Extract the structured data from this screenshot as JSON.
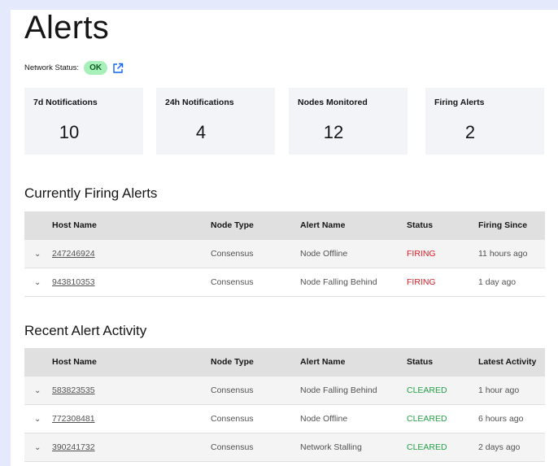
{
  "page": {
    "title": "Alerts"
  },
  "network": {
    "label": "Network Status:",
    "status": "OK",
    "icon": "external-link-icon"
  },
  "cards": [
    {
      "label": "7d Notifications",
      "value": "10"
    },
    {
      "label": "24h Notifications",
      "value": "4"
    },
    {
      "label": "Nodes Monitored",
      "value": "12"
    },
    {
      "label": "Firing Alerts",
      "value": "2"
    }
  ],
  "firing": {
    "title": "Currently Firing Alerts",
    "columns": [
      "Host Name",
      "Node Type",
      "Alert Name",
      "Status",
      "Firing Since"
    ],
    "rows": [
      {
        "host": "247246924",
        "type": "Consensus",
        "alert": "Node Offline",
        "status": "FIRING",
        "time": "11 hours ago"
      },
      {
        "host": "943810353",
        "type": "Consensus",
        "alert": "Node Falling Behind",
        "status": "FIRING",
        "time": "1 day ago"
      }
    ]
  },
  "recent": {
    "title": "Recent Alert Activity",
    "columns": [
      "Host Name",
      "Node Type",
      "Alert Name",
      "Status",
      "Latest Activity"
    ],
    "rows": [
      {
        "host": "583823535",
        "type": "Consensus",
        "alert": "Node Falling Behind",
        "status": "CLEARED",
        "time": "1 hour ago"
      },
      {
        "host": "772308481",
        "type": "Consensus",
        "alert": "Node Offline",
        "status": "CLEARED",
        "time": "6 hours ago"
      },
      {
        "host": "390241732",
        "type": "Consensus",
        "alert": "Network Stalling",
        "status": "CLEARED",
        "time": "2 days ago"
      }
    ]
  },
  "colors": {
    "link": "#0f62fe",
    "firing": "#da1e28",
    "cleared": "#24a148",
    "ok_bg": "#a7f0ba"
  }
}
